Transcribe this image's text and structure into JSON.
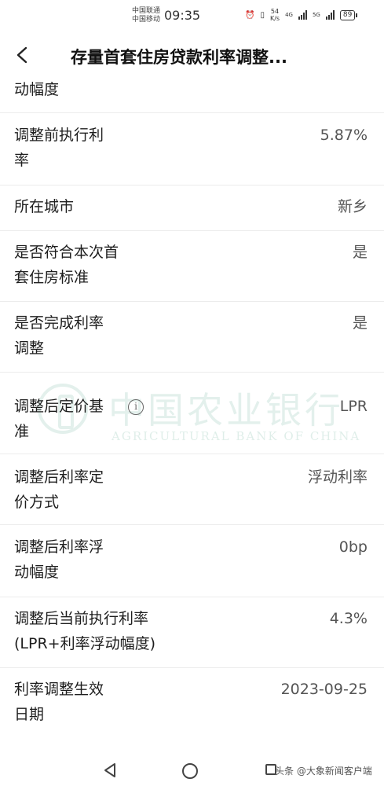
{
  "status_bar": {
    "carrier_1": "中国联通",
    "carrier_2": "中国移动",
    "time": "09:35",
    "net_speed_value": "54",
    "net_speed_unit": "K/s",
    "net_type_1": "4G",
    "net_type_2": "5G",
    "battery": "89"
  },
  "header": {
    "title": "存量首套住房贷款利率调整..."
  },
  "rows": [
    {
      "label_lines": [
        "动幅度"
      ],
      "value": ""
    },
    {
      "label_lines": [
        "调整前执行利",
        "率"
      ],
      "value": "5.87%"
    },
    {
      "label_lines": [
        "所在城市"
      ],
      "value": "新乡"
    },
    {
      "label_lines": [
        "是否符合本次首",
        "套住房标准"
      ],
      "value": "是"
    },
    {
      "label_lines": [
        "是否完成利率",
        "调整"
      ],
      "value": "是"
    },
    {
      "label_lines": [
        "调整后定价基",
        "准"
      ],
      "value": "LPR",
      "info_icon": "i"
    },
    {
      "label_lines": [
        "调整后利率定",
        "价方式"
      ],
      "value": "浮动利率"
    },
    {
      "label_lines": [
        "调整后利率浮",
        "动幅度"
      ],
      "value": "0bp"
    },
    {
      "label_lines": [
        "调整后当前执行利率",
        "(LPR+利率浮动幅度)"
      ],
      "value": "4.3%"
    },
    {
      "label_lines": [
        "利率调整生效",
        "日期"
      ],
      "value": "2023-09-25"
    }
  ],
  "watermark": {
    "name": "中国农业银行",
    "english": "AGRICULTURAL BANK OF CHINA"
  },
  "nav_bar": {
    "credit": "头条 @大象新闻客户端"
  }
}
